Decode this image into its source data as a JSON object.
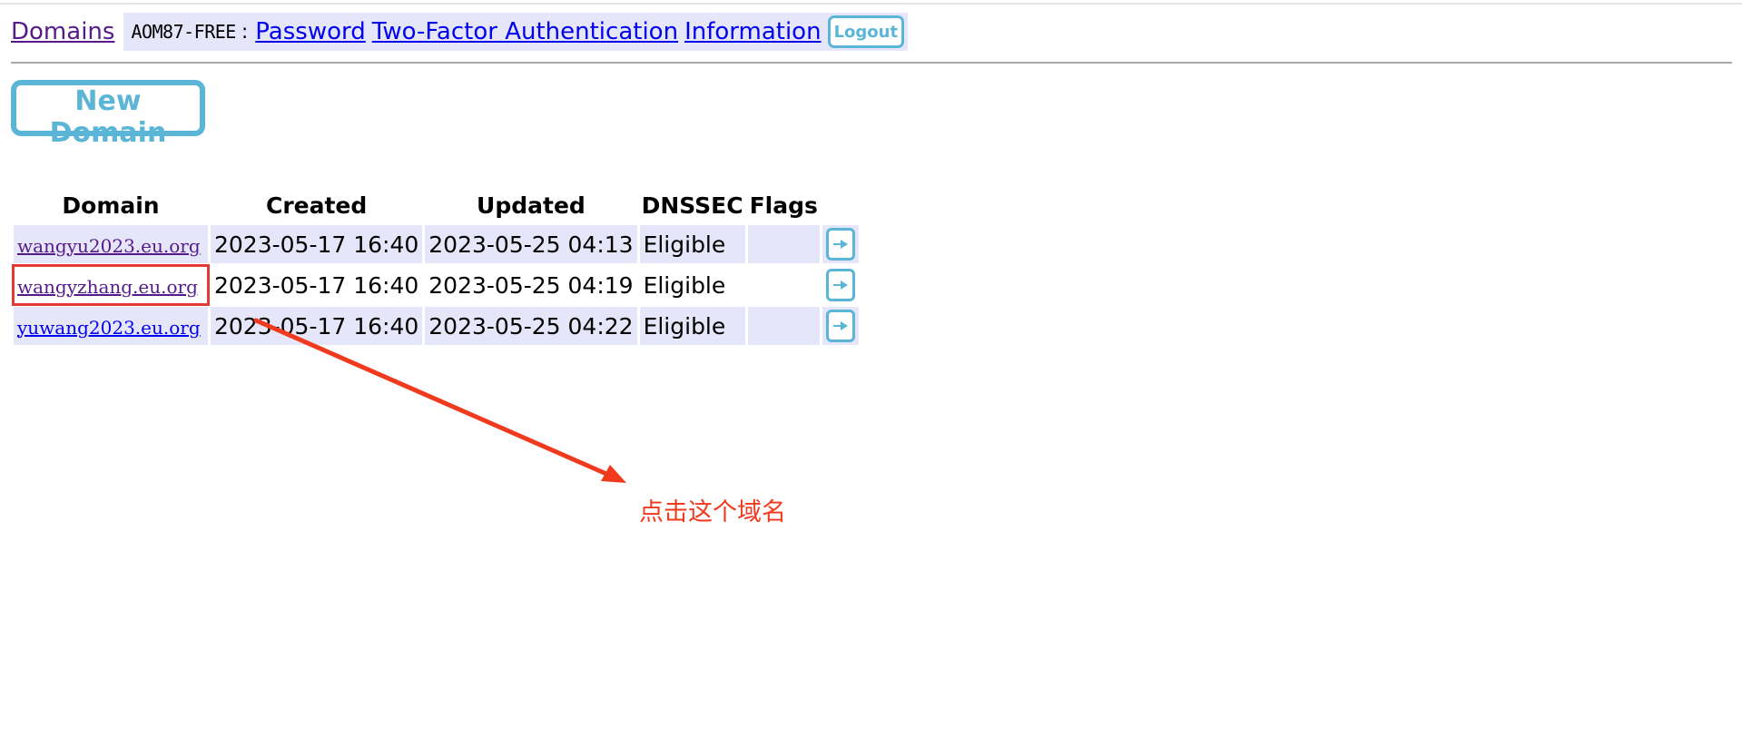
{
  "nav": {
    "domains_link": "Domains",
    "user": "AOM87-FREE",
    "separator": ":",
    "password_link": "Password",
    "two_factor_link": "Two-Factor Authentication",
    "information_link": "Information",
    "logout_label": "Logout"
  },
  "new_domain_label": "New Domain",
  "table": {
    "headers": {
      "domain": "Domain",
      "created": "Created",
      "updated": "Updated",
      "dnssec": "DNSSEC",
      "flags": "Flags"
    },
    "rows": [
      {
        "domain": "wangyu2023.eu.org",
        "created": "2023-05-17 16:40",
        "updated": "2023-05-25 04:13",
        "dnssec": "Eligible",
        "flags": ""
      },
      {
        "domain": "wangyzhang.eu.org",
        "created": "2023-05-17 16:40",
        "updated": "2023-05-25 04:19",
        "dnssec": "Eligible",
        "flags": ""
      },
      {
        "domain": "yuwang2023.eu.org",
        "created": "2023-05-17 16:40",
        "updated": "2023-05-25 04:22",
        "dnssec": "Eligible",
        "flags": ""
      }
    ]
  },
  "annotation": {
    "text": "点击这个域名",
    "color": "#f03a1e"
  },
  "colors": {
    "button_accent": "#5bb5d6",
    "row_shade": "#e6e6fa",
    "link": "#0000ee",
    "visited_link": "#551a8b",
    "highlight_box": "#e53935"
  },
  "icons": {
    "go_button": "arrow-right-icon"
  }
}
